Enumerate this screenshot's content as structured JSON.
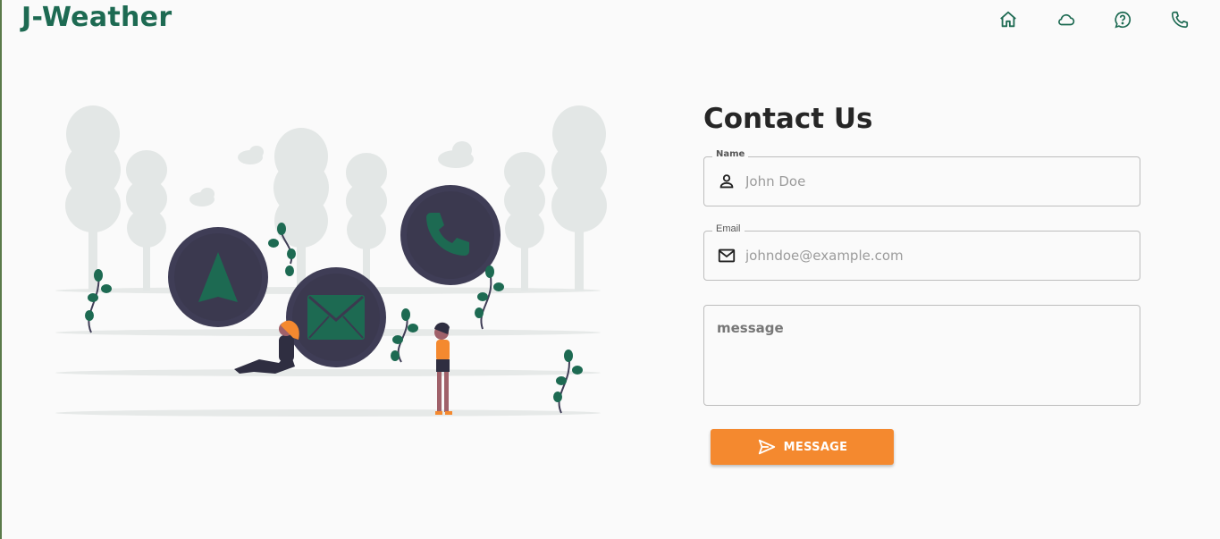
{
  "brand": {
    "title": "J-Weather"
  },
  "nav": {
    "items": [
      {
        "icon": "home-icon"
      },
      {
        "icon": "cloud-icon"
      },
      {
        "icon": "help-icon"
      },
      {
        "icon": "phone-icon"
      }
    ]
  },
  "contact": {
    "title": "Contact Us",
    "name_label": "Name",
    "name_placeholder": "John Doe",
    "email_label": "Email",
    "email_placeholder": "johndoe@example.com",
    "message_placeholder": "message",
    "submit_label": "MESSAGE"
  },
  "colors": {
    "brand": "#1d6a52",
    "accent": "#f4892f",
    "dark_circle": "#3f3d56"
  }
}
